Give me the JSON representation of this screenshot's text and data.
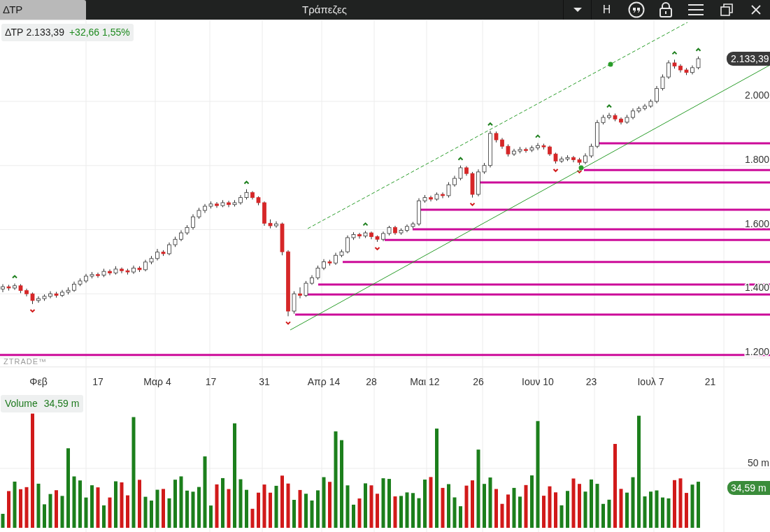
{
  "tab": {
    "label": "ΔΤΡ"
  },
  "window": {
    "title": "Τράπεζες"
  },
  "toolbar": {
    "letter_button": "H"
  },
  "legend": {
    "symbol": "ΔΤΡ",
    "price": "2.133,39",
    "change": "+32,66 1,55%"
  },
  "price_chart": {
    "last_price": "2.133,39",
    "watermark_logo": "ZTRADE™",
    "chart_data": {
      "type": "candlestick",
      "grid": true,
      "ylim": [
        1172,
        2255
      ],
      "ref_lines": [
        {
          "value": 1869,
          "axis": "y",
          "color": "#cc0b99"
        },
        {
          "value": 1786,
          "axis": "y",
          "color": "#cc0b99"
        },
        {
          "value": 1747,
          "axis": "y",
          "color": "#cc0b99"
        },
        {
          "value": 1662,
          "axis": "y",
          "color": "#cc0b99"
        },
        {
          "value": 1601,
          "axis": "y",
          "color": "#cc0b99"
        },
        {
          "value": 1568,
          "axis": "y",
          "color": "#cc0b99"
        },
        {
          "value": 1499,
          "axis": "y",
          "color": "#cc0b99"
        },
        {
          "value": 1429,
          "axis": "y",
          "color": "#cc0b99"
        },
        {
          "value": 1398,
          "axis": "y",
          "color": "#cc0b99"
        },
        {
          "value": 1335,
          "axis": "y",
          "color": "#cc0b99"
        },
        {
          "value": 1209,
          "axis": "y",
          "color": "#cc0b99"
        }
      ],
      "categories": [
        null,
        null,
        null,
        null,
        null,
        null,
        "Φεβ",
        null,
        null,
        null,
        null,
        null,
        null,
        null,
        null,
        null,
        "17",
        null,
        null,
        null,
        null,
        null,
        null,
        null,
        null,
        null,
        "Μαρ 4",
        null,
        null,
        null,
        null,
        null,
        null,
        null,
        null,
        "17",
        null,
        null,
        null,
        null,
        null,
        null,
        null,
        null,
        "31",
        null,
        null,
        null,
        null,
        null,
        null,
        null,
        null,
        null,
        "Απρ 14",
        null,
        null,
        null,
        null,
        null,
        null,
        null,
        "28",
        null,
        null,
        null,
        null,
        null,
        null,
        null,
        null,
        "Μαι 12",
        null,
        null,
        null,
        null,
        null,
        null,
        null,
        null,
        "26",
        null,
        null,
        null,
        null,
        null,
        null,
        null,
        null,
        null,
        "Ιουν 10",
        null,
        null,
        null,
        null,
        null,
        null,
        null,
        null,
        "23",
        null,
        null,
        null,
        null,
        null,
        null,
        null,
        null,
        null,
        "Ιουλ 7",
        null,
        null,
        null,
        null,
        null,
        null,
        null,
        null,
        null,
        "21"
      ],
      "yticks": [
        {
          "value": 2000,
          "label": "2.000"
        },
        {
          "value": 1800,
          "label": "1.800"
        },
        {
          "value": 1600,
          "label": "1.600"
        },
        {
          "value": 1400,
          "label": "1.400"
        },
        {
          "value": 1200,
          "label": "1.200"
        }
      ],
      "ohlc": [
        [
          1415,
          1430,
          1405,
          1422
        ],
        [
          1422,
          1428,
          1410,
          1418
        ],
        [
          1418,
          1432,
          1412,
          1425
        ],
        [
          1425,
          1430,
          1402,
          1410
        ],
        [
          1410,
          1416,
          1392,
          1400
        ],
        [
          1400,
          1404,
          1368,
          1379
        ],
        [
          1379,
          1392,
          1372,
          1385
        ],
        [
          1385,
          1398,
          1378,
          1392
        ],
        [
          1392,
          1408,
          1386,
          1400
        ],
        [
          1400,
          1406,
          1388,
          1395
        ],
        [
          1395,
          1412,
          1390,
          1405
        ],
        [
          1405,
          1420,
          1398,
          1411
        ],
        [
          1411,
          1438,
          1406,
          1430
        ],
        [
          1430,
          1448,
          1424,
          1440
        ],
        [
          1440,
          1462,
          1434,
          1455
        ],
        [
          1455,
          1468,
          1448,
          1460
        ],
        [
          1460,
          1466,
          1450,
          1458
        ],
        [
          1458,
          1478,
          1452,
          1470
        ],
        [
          1470,
          1476,
          1458,
          1465
        ],
        [
          1465,
          1486,
          1460,
          1477
        ],
        [
          1477,
          1482,
          1464,
          1472
        ],
        [
          1472,
          1478,
          1460,
          1468
        ],
        [
          1468,
          1488,
          1462,
          1480
        ],
        [
          1480,
          1486,
          1468,
          1475
        ],
        [
          1475,
          1506,
          1470,
          1499
        ],
        [
          1499,
          1518,
          1492,
          1510
        ],
        [
          1510,
          1540,
          1504,
          1530
        ],
        [
          1530,
          1536,
          1518,
          1525
        ],
        [
          1525,
          1560,
          1520,
          1553
        ],
        [
          1553,
          1578,
          1546,
          1570
        ],
        [
          1570,
          1598,
          1564,
          1590
        ],
        [
          1590,
          1614,
          1584,
          1607
        ],
        [
          1607,
          1648,
          1600,
          1640
        ],
        [
          1640,
          1668,
          1634,
          1660
        ],
        [
          1660,
          1680,
          1652,
          1673
        ],
        [
          1673,
          1688,
          1666,
          1680
        ],
        [
          1680,
          1686,
          1668,
          1675
        ],
        [
          1675,
          1692,
          1670,
          1684
        ],
        [
          1684,
          1690,
          1670,
          1678
        ],
        [
          1678,
          1692,
          1672,
          1684
        ],
        [
          1684,
          1708,
          1678,
          1700
        ],
        [
          1700,
          1726,
          1694,
          1716
        ],
        [
          1716,
          1720,
          1694,
          1700
        ],
        [
          1700,
          1704,
          1676,
          1684
        ],
        [
          1684,
          1688,
          1612,
          1620
        ],
        [
          1620,
          1632,
          1604,
          1612
        ],
        [
          1612,
          1626,
          1606,
          1618
        ],
        [
          1618,
          1622,
          1520,
          1531
        ],
        [
          1531,
          1536,
          1330,
          1346
        ],
        [
          1346,
          1408,
          1338,
          1400
        ],
        [
          1400,
          1420,
          1386,
          1395
        ],
        [
          1395,
          1440,
          1390,
          1433
        ],
        [
          1433,
          1458,
          1428,
          1450
        ],
        [
          1450,
          1488,
          1444,
          1480
        ],
        [
          1480,
          1508,
          1474,
          1500
        ],
        [
          1500,
          1506,
          1488,
          1496
        ],
        [
          1496,
          1528,
          1490,
          1520
        ],
        [
          1520,
          1538,
          1514,
          1531
        ],
        [
          1531,
          1582,
          1526,
          1575
        ],
        [
          1575,
          1592,
          1568,
          1585
        ],
        [
          1585,
          1590,
          1572,
          1580
        ],
        [
          1580,
          1596,
          1574,
          1590
        ],
        [
          1590,
          1594,
          1570,
          1578
        ],
        [
          1578,
          1582,
          1562,
          1570
        ],
        [
          1570,
          1594,
          1564,
          1588
        ],
        [
          1588,
          1612,
          1582,
          1607
        ],
        [
          1607,
          1612,
          1584,
          1590
        ],
        [
          1590,
          1604,
          1584,
          1598
        ],
        [
          1598,
          1616,
          1592,
          1610
        ],
        [
          1610,
          1624,
          1604,
          1618
        ],
        [
          1618,
          1698,
          1612,
          1690
        ],
        [
          1690,
          1708,
          1684,
          1700
        ],
        [
          1700,
          1706,
          1688,
          1695
        ],
        [
          1695,
          1716,
          1690,
          1710
        ],
        [
          1710,
          1716,
          1698,
          1706
        ],
        [
          1706,
          1748,
          1700,
          1740
        ],
        [
          1740,
          1768,
          1734,
          1760
        ],
        [
          1760,
          1800,
          1754,
          1793
        ],
        [
          1793,
          1798,
          1768,
          1775
        ],
        [
          1775,
          1780,
          1700,
          1710
        ],
        [
          1710,
          1788,
          1704,
          1780
        ],
        [
          1780,
          1808,
          1774,
          1800
        ],
        [
          1800,
          1908,
          1794,
          1900
        ],
        [
          1900,
          1906,
          1872,
          1880
        ],
        [
          1880,
          1886,
          1852,
          1860
        ],
        [
          1860,
          1866,
          1828,
          1836
        ],
        [
          1836,
          1852,
          1830,
          1845
        ],
        [
          1845,
          1858,
          1838,
          1850
        ],
        [
          1850,
          1856,
          1840,
          1848
        ],
        [
          1848,
          1862,
          1842,
          1855
        ],
        [
          1855,
          1870,
          1848,
          1862
        ],
        [
          1862,
          1868,
          1850,
          1858
        ],
        [
          1858,
          1862,
          1830,
          1836
        ],
        [
          1836,
          1840,
          1806,
          1814
        ],
        [
          1814,
          1828,
          1808,
          1820
        ],
        [
          1820,
          1832,
          1814,
          1825
        ],
        [
          1825,
          1830,
          1810,
          1818
        ],
        [
          1818,
          1824,
          1802,
          1810
        ],
        [
          1810,
          1838,
          1804,
          1830
        ],
        [
          1830,
          1868,
          1824,
          1860
        ],
        [
          1860,
          1942,
          1854,
          1934
        ],
        [
          1934,
          1958,
          1928,
          1950
        ],
        [
          1950,
          1964,
          1944,
          1956
        ],
        [
          1956,
          1962,
          1938,
          1945
        ],
        [
          1945,
          1950,
          1928,
          1935
        ],
        [
          1935,
          1958,
          1930,
          1950
        ],
        [
          1950,
          1978,
          1944,
          1970
        ],
        [
          1970,
          1984,
          1964,
          1978
        ],
        [
          1978,
          1992,
          1972,
          1985
        ],
        [
          1985,
          2006,
          1980,
          2000
        ],
        [
          2000,
          2048,
          1994,
          2040
        ],
        [
          2040,
          2084,
          2034,
          2076
        ],
        [
          2076,
          2128,
          2070,
          2120
        ],
        [
          2120,
          2130,
          2102,
          2110
        ],
        [
          2110,
          2116,
          2090,
          2098
        ],
        [
          2098,
          2104,
          2082,
          2090
        ],
        [
          2090,
          2112,
          2084,
          2105
        ],
        [
          2105,
          2140,
          2100,
          2133
        ],
        null,
        null
      ]
    }
  },
  "volume": {
    "label": "Volume",
    "value": "34,59 m",
    "axis_label": "50 m",
    "last_value": "34,59 m"
  }
}
